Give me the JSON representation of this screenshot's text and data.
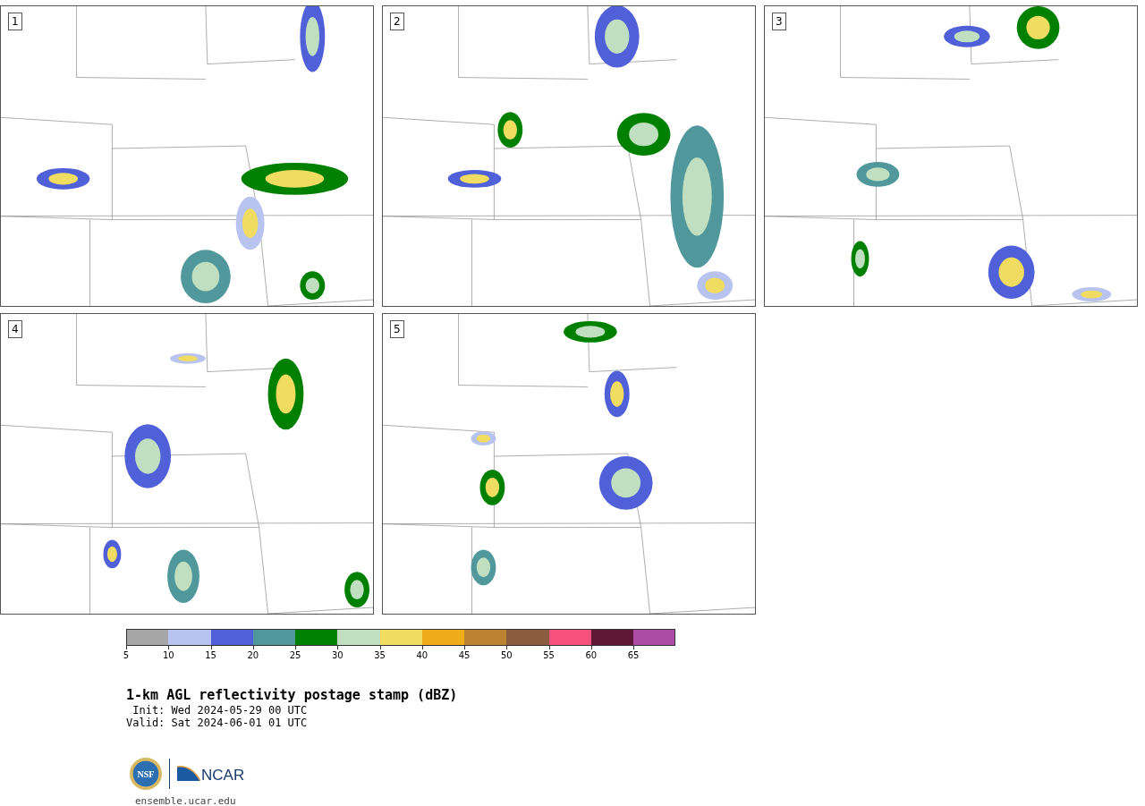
{
  "panels": [
    {
      "label": "1"
    },
    {
      "label": "2"
    },
    {
      "label": "3"
    },
    {
      "label": "4"
    },
    {
      "label": "5"
    }
  ],
  "colorbar": [
    {
      "tick": "5",
      "color": "#a6a6a6"
    },
    {
      "tick": "10",
      "color": "#b8c4ef"
    },
    {
      "tick": "15",
      "color": "#5060d8"
    },
    {
      "tick": "20",
      "color": "#50989c"
    },
    {
      "tick": "25",
      "color": "#008000"
    },
    {
      "tick": "30",
      "color": "#c0dfc0"
    },
    {
      "tick": "35",
      "color": "#f0dc60"
    },
    {
      "tick": "40",
      "color": "#f0ac18"
    },
    {
      "tick": "45",
      "color": "#bc8430"
    },
    {
      "tick": "50",
      "color": "#8c5c40"
    },
    {
      "tick": "55",
      "color": "#f8507c"
    },
    {
      "tick": "60",
      "color": "#601838"
    },
    {
      "tick": "65",
      "color": "#ac4ca4"
    }
  ],
  "title": "1-km AGL reflectivity postage stamp (dBZ)",
  "init": " Init: Wed 2024-05-29 00 UTC",
  "valid": "Valid: Sat 2024-06-01 01 UTC",
  "logos": {
    "left": "NSF",
    "right": "NCAR"
  },
  "url": "ensemble.ucar.edu"
}
